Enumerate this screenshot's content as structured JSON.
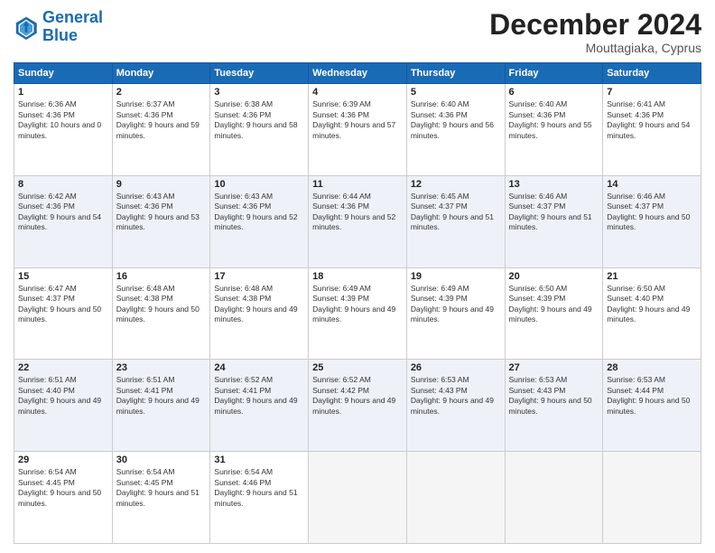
{
  "header": {
    "logo_line1": "General",
    "logo_line2": "Blue",
    "month": "December 2024",
    "location": "Mouttagiaka, Cyprus"
  },
  "weekdays": [
    "Sunday",
    "Monday",
    "Tuesday",
    "Wednesday",
    "Thursday",
    "Friday",
    "Saturday"
  ],
  "weeks": [
    [
      {
        "day": "1",
        "sunrise": "Sunrise: 6:36 AM",
        "sunset": "Sunset: 4:36 PM",
        "daylight": "Daylight: 10 hours and 0 minutes."
      },
      {
        "day": "2",
        "sunrise": "Sunrise: 6:37 AM",
        "sunset": "Sunset: 4:36 PM",
        "daylight": "Daylight: 9 hours and 59 minutes."
      },
      {
        "day": "3",
        "sunrise": "Sunrise: 6:38 AM",
        "sunset": "Sunset: 4:36 PM",
        "daylight": "Daylight: 9 hours and 58 minutes."
      },
      {
        "day": "4",
        "sunrise": "Sunrise: 6:39 AM",
        "sunset": "Sunset: 4:36 PM",
        "daylight": "Daylight: 9 hours and 57 minutes."
      },
      {
        "day": "5",
        "sunrise": "Sunrise: 6:40 AM",
        "sunset": "Sunset: 4:36 PM",
        "daylight": "Daylight: 9 hours and 56 minutes."
      },
      {
        "day": "6",
        "sunrise": "Sunrise: 6:40 AM",
        "sunset": "Sunset: 4:36 PM",
        "daylight": "Daylight: 9 hours and 55 minutes."
      },
      {
        "day": "7",
        "sunrise": "Sunrise: 6:41 AM",
        "sunset": "Sunset: 4:36 PM",
        "daylight": "Daylight: 9 hours and 54 minutes."
      }
    ],
    [
      {
        "day": "8",
        "sunrise": "Sunrise: 6:42 AM",
        "sunset": "Sunset: 4:36 PM",
        "daylight": "Daylight: 9 hours and 54 minutes."
      },
      {
        "day": "9",
        "sunrise": "Sunrise: 6:43 AM",
        "sunset": "Sunset: 4:36 PM",
        "daylight": "Daylight: 9 hours and 53 minutes."
      },
      {
        "day": "10",
        "sunrise": "Sunrise: 6:43 AM",
        "sunset": "Sunset: 4:36 PM",
        "daylight": "Daylight: 9 hours and 52 minutes."
      },
      {
        "day": "11",
        "sunrise": "Sunrise: 6:44 AM",
        "sunset": "Sunset: 4:36 PM",
        "daylight": "Daylight: 9 hours and 52 minutes."
      },
      {
        "day": "12",
        "sunrise": "Sunrise: 6:45 AM",
        "sunset": "Sunset: 4:37 PM",
        "daylight": "Daylight: 9 hours and 51 minutes."
      },
      {
        "day": "13",
        "sunrise": "Sunrise: 6:46 AM",
        "sunset": "Sunset: 4:37 PM",
        "daylight": "Daylight: 9 hours and 51 minutes."
      },
      {
        "day": "14",
        "sunrise": "Sunrise: 6:46 AM",
        "sunset": "Sunset: 4:37 PM",
        "daylight": "Daylight: 9 hours and 50 minutes."
      }
    ],
    [
      {
        "day": "15",
        "sunrise": "Sunrise: 6:47 AM",
        "sunset": "Sunset: 4:37 PM",
        "daylight": "Daylight: 9 hours and 50 minutes."
      },
      {
        "day": "16",
        "sunrise": "Sunrise: 6:48 AM",
        "sunset": "Sunset: 4:38 PM",
        "daylight": "Daylight: 9 hours and 50 minutes."
      },
      {
        "day": "17",
        "sunrise": "Sunrise: 6:48 AM",
        "sunset": "Sunset: 4:38 PM",
        "daylight": "Daylight: 9 hours and 49 minutes."
      },
      {
        "day": "18",
        "sunrise": "Sunrise: 6:49 AM",
        "sunset": "Sunset: 4:39 PM",
        "daylight": "Daylight: 9 hours and 49 minutes."
      },
      {
        "day": "19",
        "sunrise": "Sunrise: 6:49 AM",
        "sunset": "Sunset: 4:39 PM",
        "daylight": "Daylight: 9 hours and 49 minutes."
      },
      {
        "day": "20",
        "sunrise": "Sunrise: 6:50 AM",
        "sunset": "Sunset: 4:39 PM",
        "daylight": "Daylight: 9 hours and 49 minutes."
      },
      {
        "day": "21",
        "sunrise": "Sunrise: 6:50 AM",
        "sunset": "Sunset: 4:40 PM",
        "daylight": "Daylight: 9 hours and 49 minutes."
      }
    ],
    [
      {
        "day": "22",
        "sunrise": "Sunrise: 6:51 AM",
        "sunset": "Sunset: 4:40 PM",
        "daylight": "Daylight: 9 hours and 49 minutes."
      },
      {
        "day": "23",
        "sunrise": "Sunrise: 6:51 AM",
        "sunset": "Sunset: 4:41 PM",
        "daylight": "Daylight: 9 hours and 49 minutes."
      },
      {
        "day": "24",
        "sunrise": "Sunrise: 6:52 AM",
        "sunset": "Sunset: 4:41 PM",
        "daylight": "Daylight: 9 hours and 49 minutes."
      },
      {
        "day": "25",
        "sunrise": "Sunrise: 6:52 AM",
        "sunset": "Sunset: 4:42 PM",
        "daylight": "Daylight: 9 hours and 49 minutes."
      },
      {
        "day": "26",
        "sunrise": "Sunrise: 6:53 AM",
        "sunset": "Sunset: 4:43 PM",
        "daylight": "Daylight: 9 hours and 49 minutes."
      },
      {
        "day": "27",
        "sunrise": "Sunrise: 6:53 AM",
        "sunset": "Sunset: 4:43 PM",
        "daylight": "Daylight: 9 hours and 50 minutes."
      },
      {
        "day": "28",
        "sunrise": "Sunrise: 6:53 AM",
        "sunset": "Sunset: 4:44 PM",
        "daylight": "Daylight: 9 hours and 50 minutes."
      }
    ],
    [
      {
        "day": "29",
        "sunrise": "Sunrise: 6:54 AM",
        "sunset": "Sunset: 4:45 PM",
        "daylight": "Daylight: 9 hours and 50 minutes."
      },
      {
        "day": "30",
        "sunrise": "Sunrise: 6:54 AM",
        "sunset": "Sunset: 4:45 PM",
        "daylight": "Daylight: 9 hours and 51 minutes."
      },
      {
        "day": "31",
        "sunrise": "Sunrise: 6:54 AM",
        "sunset": "Sunset: 4:46 PM",
        "daylight": "Daylight: 9 hours and 51 minutes."
      },
      null,
      null,
      null,
      null
    ]
  ]
}
